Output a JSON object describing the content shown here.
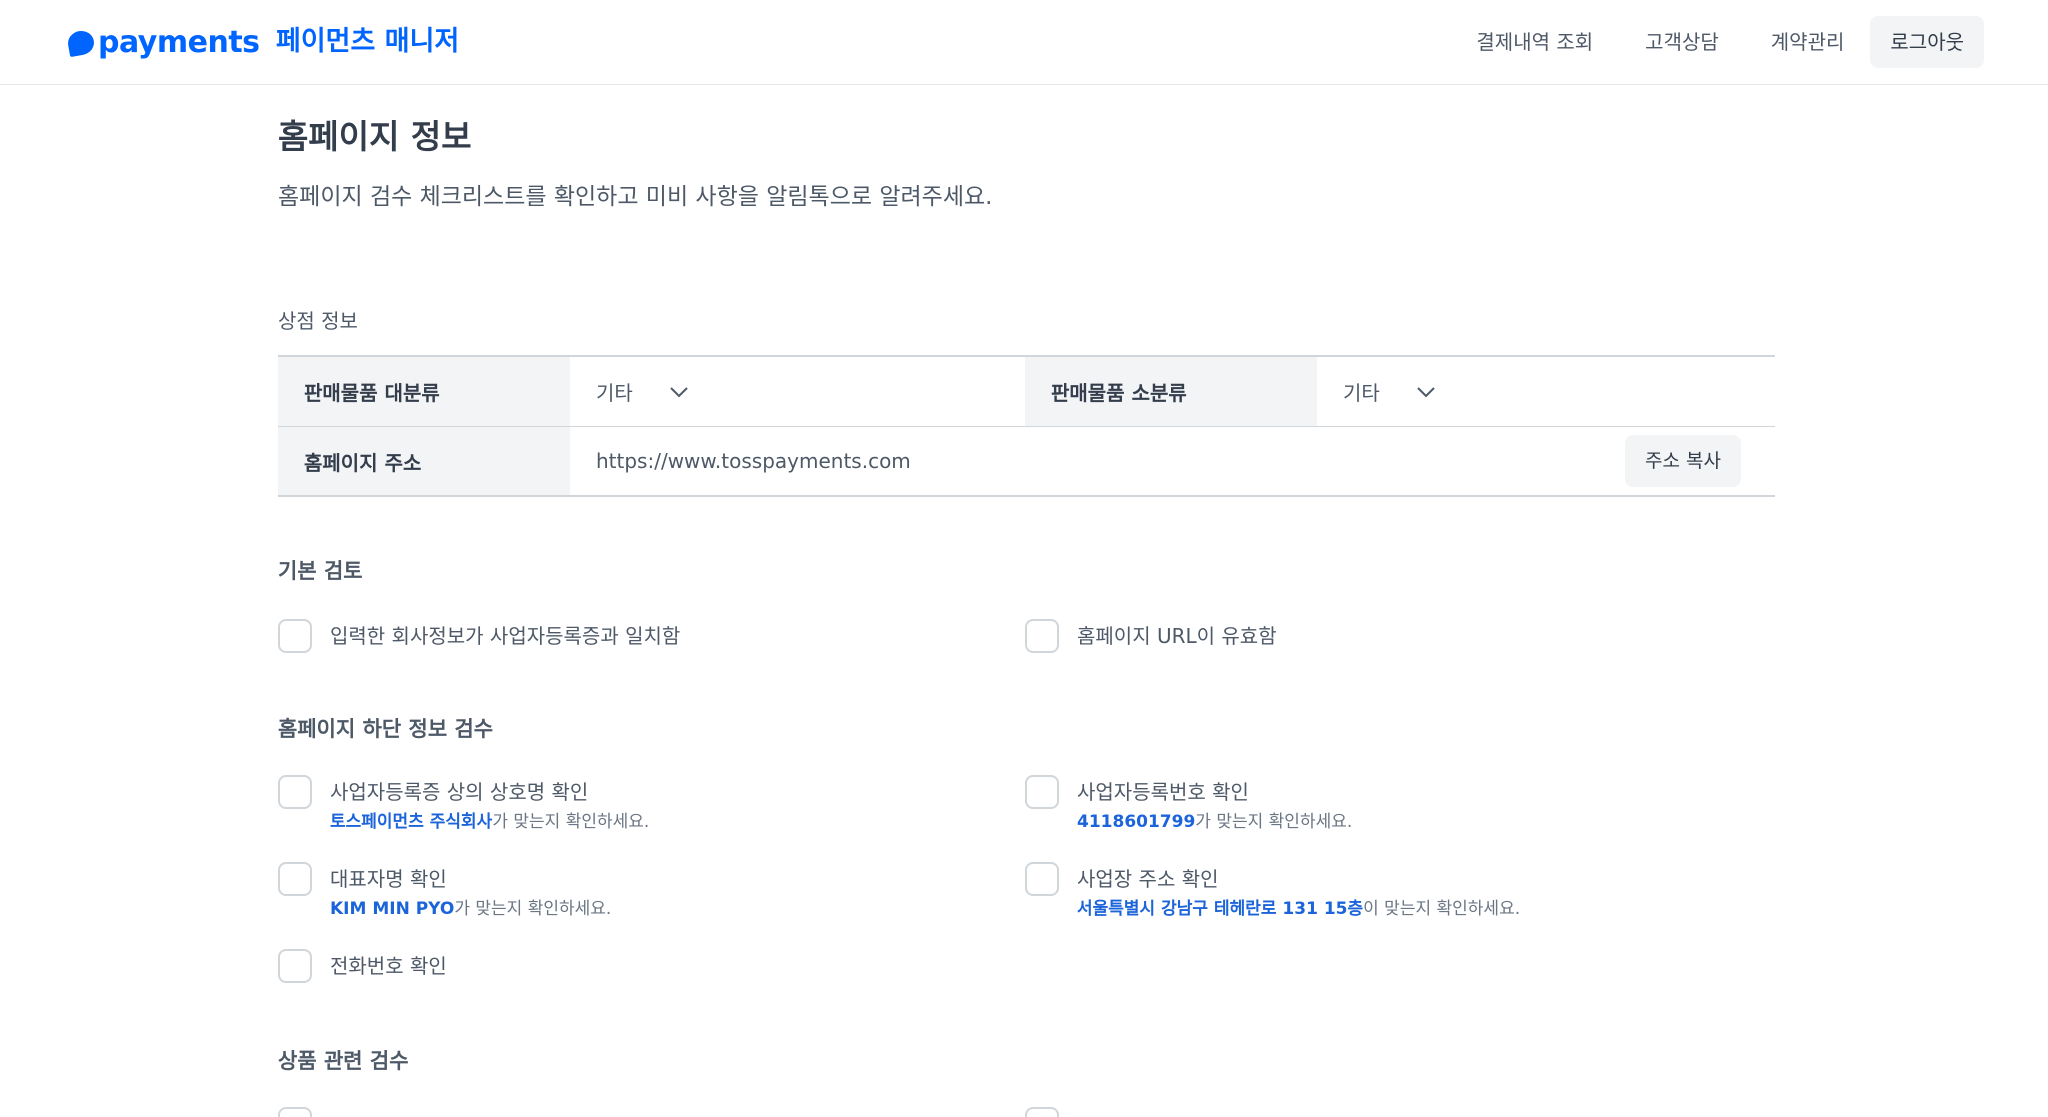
{
  "header": {
    "logo_text": "payments",
    "title": "페이먼츠 매니저",
    "nav": [
      {
        "label": "결제내역 조회"
      },
      {
        "label": "고객상담"
      },
      {
        "label": "계약관리"
      }
    ],
    "logout_label": "로그아웃"
  },
  "page": {
    "title": "홈페이지 정보",
    "description": "홈페이지 검수 체크리스트를 확인하고 미비 사항을 알림톡으로 알려주세요."
  },
  "store_info": {
    "section_label": "상점 정보",
    "rows": {
      "category_major_label": "판매물품 대분류",
      "category_major_value": "기타",
      "category_minor_label": "판매물품 소분류",
      "category_minor_value": "기타",
      "homepage_label": "홈페이지 주소",
      "homepage_value": "https://www.tosspayments.com",
      "copy_button": "주소 복사"
    }
  },
  "basic_review": {
    "heading": "기본 검토",
    "items": [
      {
        "label": "입력한 회사정보가 사업자등록증과 일치함"
      },
      {
        "label": "홈페이지 URL이 유효함"
      }
    ]
  },
  "footer_review": {
    "heading": "홈페이지 하단 정보 검수",
    "items": [
      {
        "label": "사업자등록증 상의 상호명 확인",
        "highlight": "토스페이먼츠 주식회사",
        "suffix": "가 맞는지 확인하세요."
      },
      {
        "label": "사업자등록번호 확인",
        "highlight": "4118601799",
        "suffix": "가 맞는지 확인하세요."
      },
      {
        "label": "대표자명 확인",
        "highlight": "KIM MIN PYO",
        "suffix": "가 맞는지 확인하세요."
      },
      {
        "label": "사업장 주소 확인",
        "highlight": "서울특별시 강남구 테헤란로 131 15층",
        "suffix": "이 맞는지 확인하세요."
      },
      {
        "label": "전화번호 확인"
      }
    ]
  },
  "product_review": {
    "heading": "상품 관련 검수"
  },
  "colors": {
    "brand": "#0064ff",
    "highlight": "#1b64da",
    "table_head_bg": "#f2f4f6"
  }
}
